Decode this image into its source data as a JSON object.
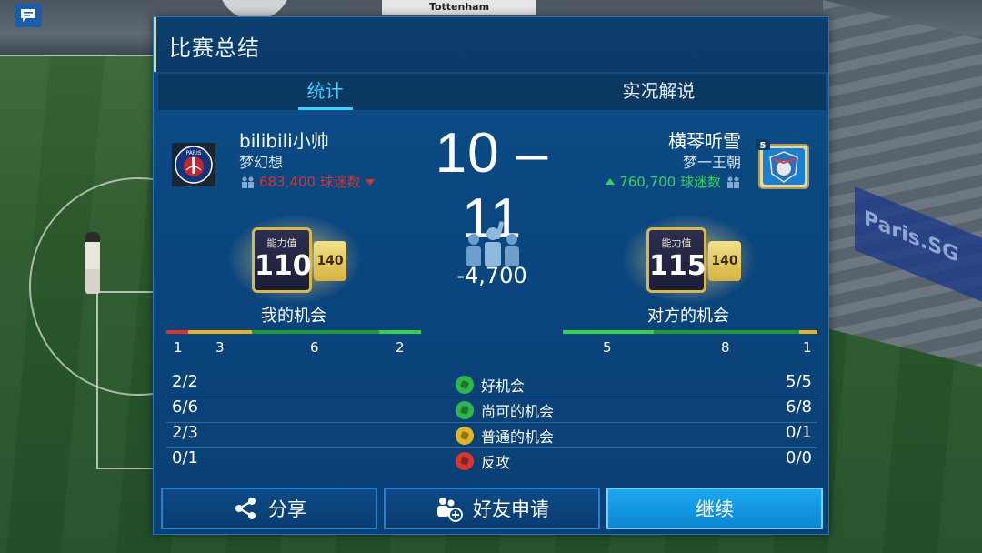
{
  "background": {
    "top_banner_text": "Tottenham",
    "side_banner_text": "Paris.SG"
  },
  "panel": {
    "title": "比赛总结",
    "tabs": [
      {
        "label": "统计",
        "active": true
      },
      {
        "label": "实况解说",
        "active": false
      }
    ]
  },
  "match": {
    "home": {
      "name": "bilibili小帅",
      "club": "梦幻想",
      "fans_text": "683,400 球迷数",
      "fans_trend": "down",
      "crest_text": "PARIS",
      "rating_label": "能力值",
      "rating": "110",
      "rating_alt": "140",
      "chance_title": "我的机会",
      "bar_values": [
        "1",
        "3",
        "6",
        "2"
      ]
    },
    "away": {
      "name": "横琴听雪",
      "club": "梦一王朝",
      "fans_text": "760,700 球迷数",
      "fans_trend": "up",
      "crest_level": "5",
      "rating_label": "能力值",
      "rating": "115",
      "rating_alt": "140",
      "chance_title": "对方的机会",
      "bar_values": [
        "5",
        "8",
        "1"
      ]
    },
    "score": "10 – 11",
    "fan_change": "-4,700"
  },
  "stats": [
    {
      "label": "好机会",
      "home": "2/2",
      "away": "5/5",
      "color": "#2fb64a"
    },
    {
      "label": "尚可的机会",
      "home": "6/6",
      "away": "6/8",
      "color": "#2fb64a"
    },
    {
      "label": "普通的机会",
      "home": "2/3",
      "away": "0/1",
      "color": "#e3b42a"
    },
    {
      "label": "反攻",
      "home": "0/1",
      "away": "0/0",
      "color": "#d8362f"
    }
  ],
  "buttons": {
    "share": "分享",
    "add_friend": "好友申请",
    "continue": "继续"
  },
  "colors": {
    "accent": "#3fd0ff",
    "panel": "#0b4580",
    "primary_button": "#1a9fe8",
    "fans_down": "#d2342f",
    "fans_up": "#35d25a"
  }
}
